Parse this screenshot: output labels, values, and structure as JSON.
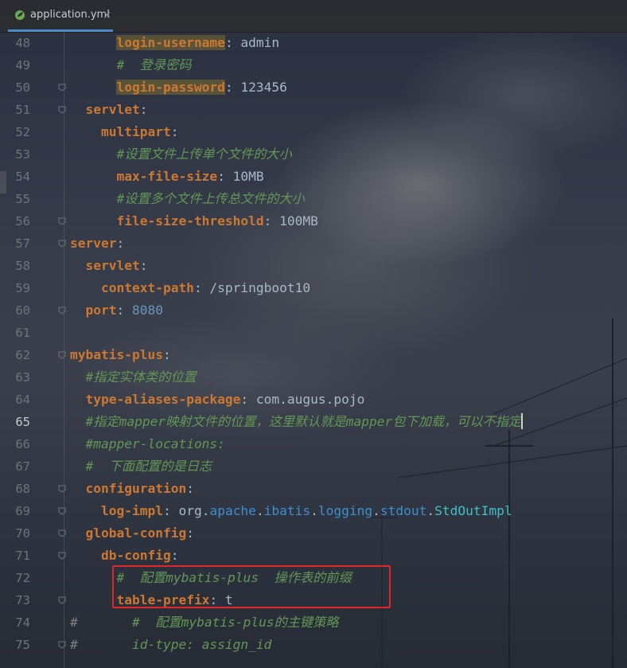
{
  "tab": {
    "filename": "application.yml",
    "close": "×"
  },
  "lines": [
    {
      "num": "48",
      "parts": [
        {
          "t": "      "
        },
        {
          "t": "login-username",
          "c": "k hl"
        },
        {
          "t": ": admin",
          "c": "v"
        }
      ]
    },
    {
      "num": "49",
      "parts": [
        {
          "t": "      "
        },
        {
          "t": "#  登录密码",
          "c": "c"
        }
      ]
    },
    {
      "num": "50",
      "parts": [
        {
          "t": "      "
        },
        {
          "t": "login-password",
          "c": "k hl"
        },
        {
          "t": ": 123456",
          "c": "v"
        }
      ]
    },
    {
      "num": "51",
      "parts": [
        {
          "t": "  "
        },
        {
          "t": "servlet",
          "c": "k"
        },
        {
          "t": ":",
          "c": "p"
        }
      ]
    },
    {
      "num": "52",
      "parts": [
        {
          "t": "    "
        },
        {
          "t": "multipart",
          "c": "k"
        },
        {
          "t": ":",
          "c": "p"
        }
      ]
    },
    {
      "num": "53",
      "parts": [
        {
          "t": "      "
        },
        {
          "t": "#设置文件上传单个文件的大小",
          "c": "c"
        }
      ]
    },
    {
      "num": "54",
      "parts": [
        {
          "t": "      "
        },
        {
          "t": "max-file-size",
          "c": "k"
        },
        {
          "t": ": 10MB",
          "c": "v"
        }
      ]
    },
    {
      "num": "55",
      "parts": [
        {
          "t": "      "
        },
        {
          "t": "#设置多个文件上传总文件的大小",
          "c": "c"
        }
      ]
    },
    {
      "num": "56",
      "parts": [
        {
          "t": "      "
        },
        {
          "t": "file-size-threshold",
          "c": "k"
        },
        {
          "t": ": 100MB",
          "c": "v"
        }
      ]
    },
    {
      "num": "57",
      "parts": [
        {
          "t": "server",
          "c": "k"
        },
        {
          "t": ":",
          "c": "p"
        }
      ]
    },
    {
      "num": "58",
      "parts": [
        {
          "t": "  "
        },
        {
          "t": "servlet",
          "c": "k"
        },
        {
          "t": ":",
          "c": "p"
        }
      ]
    },
    {
      "num": "59",
      "parts": [
        {
          "t": "    "
        },
        {
          "t": "context-path",
          "c": "k"
        },
        {
          "t": ": /springboot10",
          "c": "v"
        }
      ]
    },
    {
      "num": "60",
      "parts": [
        {
          "t": "  "
        },
        {
          "t": "port",
          "c": "k"
        },
        {
          "t": ": ",
          "c": "p"
        },
        {
          "t": "8080",
          "c": "n"
        }
      ]
    },
    {
      "num": "61",
      "parts": []
    },
    {
      "num": "62",
      "parts": [
        {
          "t": "mybatis-plus",
          "c": "k"
        },
        {
          "t": ":",
          "c": "p"
        }
      ]
    },
    {
      "num": "63",
      "parts": [
        {
          "t": "  "
        },
        {
          "t": "#指定实体类的位置",
          "c": "c"
        }
      ]
    },
    {
      "num": "64",
      "parts": [
        {
          "t": "  "
        },
        {
          "t": "type-aliases-package",
          "c": "k"
        },
        {
          "t": ": com.augus.pojo",
          "c": "v"
        }
      ]
    },
    {
      "num": "65",
      "parts": [
        {
          "t": "  "
        },
        {
          "t": "#指定mapper映射文件的位置，这里默认就是mapper包下加载，可以不指定",
          "c": "c"
        }
      ],
      "cursor": true
    },
    {
      "num": "66",
      "parts": [
        {
          "t": "  "
        },
        {
          "t": "#mapper-locations:",
          "c": "c"
        }
      ]
    },
    {
      "num": "67",
      "parts": [
        {
          "t": "  "
        },
        {
          "t": "#  下面配置的是日志",
          "c": "c"
        }
      ]
    },
    {
      "num": "68",
      "parts": [
        {
          "t": "  "
        },
        {
          "t": "configuration",
          "c": "k"
        },
        {
          "t": ":",
          "c": "p"
        }
      ]
    },
    {
      "num": "69",
      "parts": [
        {
          "t": "    "
        },
        {
          "t": "log-impl",
          "c": "k"
        },
        {
          "t": ": ",
          "c": "p"
        },
        {
          "t": "org",
          "c": "pkg"
        },
        {
          "t": ".",
          "c": "p"
        },
        {
          "t": "apache",
          "c": "cls"
        },
        {
          "t": ".",
          "c": "p"
        },
        {
          "t": "ibatis",
          "c": "cls"
        },
        {
          "t": ".",
          "c": "p"
        },
        {
          "t": "logging",
          "c": "cls"
        },
        {
          "t": ".",
          "c": "p"
        },
        {
          "t": "stdout",
          "c": "cls"
        },
        {
          "t": ".",
          "c": "p"
        },
        {
          "t": "StdOutImpl",
          "c": "cls2"
        }
      ]
    },
    {
      "num": "70",
      "parts": [
        {
          "t": "  "
        },
        {
          "t": "global-config",
          "c": "k"
        },
        {
          "t": ":",
          "c": "p"
        }
      ]
    },
    {
      "num": "71",
      "parts": [
        {
          "t": "    "
        },
        {
          "t": "db-config",
          "c": "k"
        },
        {
          "t": ":",
          "c": "p"
        }
      ]
    },
    {
      "num": "72",
      "parts": [
        {
          "t": "      "
        },
        {
          "t": "#  配置mybatis-plus  操作表的前缀",
          "c": "c"
        }
      ]
    },
    {
      "num": "73",
      "parts": [
        {
          "t": "      "
        },
        {
          "t": "table-prefix",
          "c": "k"
        },
        {
          "t": ": t_",
          "c": "v"
        }
      ]
    },
    {
      "num": "74",
      "parts": [
        {
          "t": "#       ",
          "c": "cg"
        },
        {
          "t": "#  配置mybatis-plus的主键策略",
          "c": "c"
        }
      ]
    },
    {
      "num": "75",
      "parts": [
        {
          "t": "#       ",
          "c": "cg"
        },
        {
          "t": "id-type: assign_id",
          "c": "c"
        }
      ]
    }
  ],
  "active_line": "65",
  "icon": "spring-leaf-icon"
}
